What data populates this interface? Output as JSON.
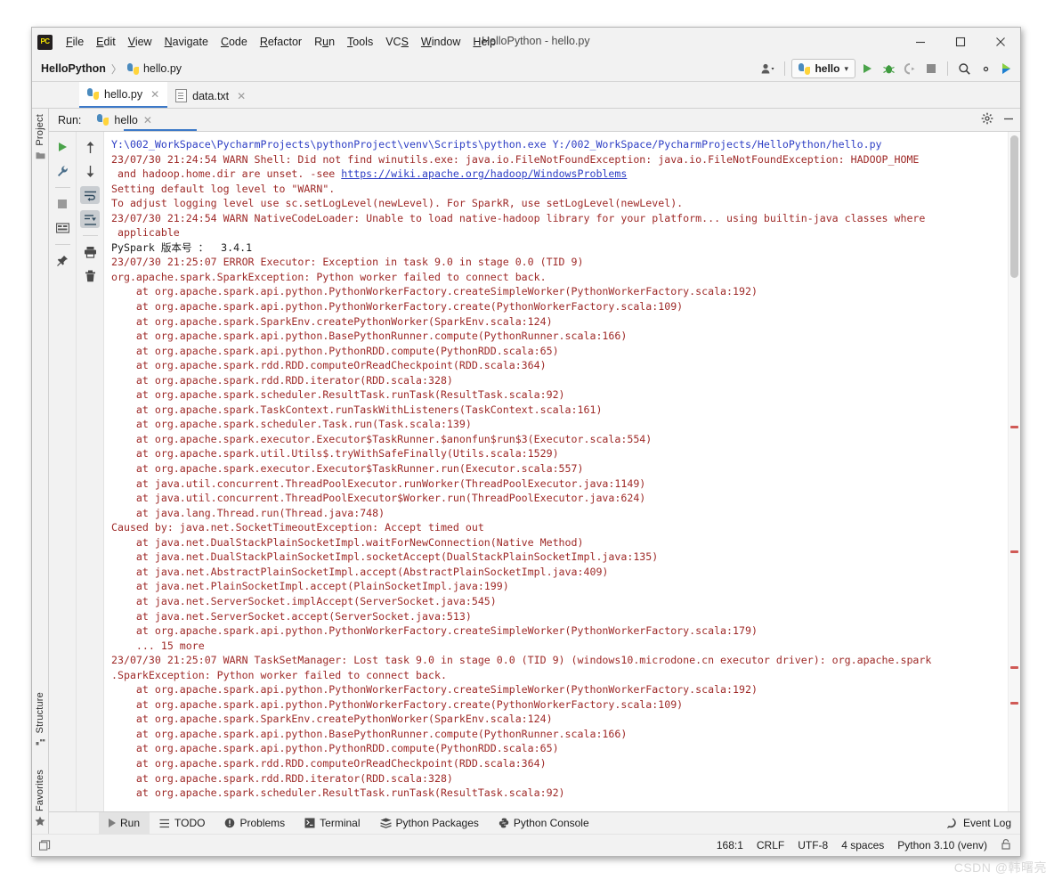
{
  "window": {
    "title": "HelloPython - hello.py",
    "logo_text": "PC",
    "minimize": "—",
    "maximize": "☐",
    "close": "✕"
  },
  "menu": [
    {
      "label": "File"
    },
    {
      "label": "Edit"
    },
    {
      "label": "View"
    },
    {
      "label": "Navigate"
    },
    {
      "label": "Code"
    },
    {
      "label": "Refactor"
    },
    {
      "label": "Run"
    },
    {
      "label": "Tools"
    },
    {
      "label": "VCS"
    },
    {
      "label": "Window"
    },
    {
      "label": "Help"
    }
  ],
  "breadcrumb": {
    "project": "HelloPython",
    "separator": "〉",
    "file": "hello.py"
  },
  "toolbar": {
    "run_config": "hello",
    "dropdown_caret": "▾",
    "icons": [
      "user-avatar-icon",
      "run-icon",
      "debug-icon",
      "coverage-icon",
      "stop-icon",
      "search-icon",
      "settings-icon",
      "updates-icon"
    ]
  },
  "editor_tabs": [
    {
      "label": "hello.py",
      "icon": "python-file-icon",
      "active": true,
      "close": "✕"
    },
    {
      "label": "data.txt",
      "icon": "text-file-icon",
      "active": false,
      "close": "✕"
    }
  ],
  "left_strip": {
    "project": "Project",
    "structure": "Structure",
    "favorites": "Favorites"
  },
  "run_panel": {
    "title": "Run:",
    "tab_label": "hello",
    "tab_close": "✕",
    "settings_icon": "gear-icon",
    "minimize_icon": "minimize-icon",
    "gutter_left": [
      "rerun-icon",
      "settings-wrench-icon",
      "stop-icon",
      "layout-icon",
      "pin-icon"
    ],
    "gutter_right": [
      "up-arrow-icon",
      "down-arrow-icon",
      "soft-wrap-icon",
      "scroll-to-end-icon",
      "print-icon",
      "trash-icon"
    ]
  },
  "console": {
    "lines": [
      {
        "t": "Y:\\002_WorkSpace\\PycharmProjects\\pythonProject\\venv\\Scripts\\python.exe Y:/002_WorkSpace/PycharmProjects/HelloPython/hello.py",
        "c": "blue"
      },
      {
        "t": "23/07/30 21:24:54 WARN Shell: Did not find winutils.exe: java.io.FileNotFoundException: java.io.FileNotFoundException: HADOOP_HOME",
        "c": "red"
      },
      {
        "t": " and hadoop.home.dir are unset. -see ",
        "c": "red",
        "link": "https://wiki.apache.org/hadoop/WindowsProblems"
      },
      {
        "t": "Setting default log level to \"WARN\".",
        "c": "red"
      },
      {
        "t": "To adjust logging level use sc.setLogLevel(newLevel). For SparkR, use setLogLevel(newLevel).",
        "c": "red"
      },
      {
        "t": "23/07/30 21:24:54 WARN NativeCodeLoader: Unable to load native-hadoop library for your platform... using builtin-java classes where",
        "c": "red"
      },
      {
        "t": " applicable",
        "c": "red"
      },
      {
        "t": "PySpark 版本号 ：  3.4.1",
        "c": "black"
      },
      {
        "t": "23/07/30 21:25:07 ERROR Executor: Exception in task 9.0 in stage 0.0 (TID 9)",
        "c": "red"
      },
      {
        "t": "org.apache.spark.SparkException: Python worker failed to connect back.",
        "c": "red"
      },
      {
        "t": "    at org.apache.spark.api.python.PythonWorkerFactory.createSimpleWorker(PythonWorkerFactory.scala:192)",
        "c": "red"
      },
      {
        "t": "    at org.apache.spark.api.python.PythonWorkerFactory.create(PythonWorkerFactory.scala:109)",
        "c": "red"
      },
      {
        "t": "    at org.apache.spark.SparkEnv.createPythonWorker(SparkEnv.scala:124)",
        "c": "red"
      },
      {
        "t": "    at org.apache.spark.api.python.BasePythonRunner.compute(PythonRunner.scala:166)",
        "c": "red"
      },
      {
        "t": "    at org.apache.spark.api.python.PythonRDD.compute(PythonRDD.scala:65)",
        "c": "red"
      },
      {
        "t": "    at org.apache.spark.rdd.RDD.computeOrReadCheckpoint(RDD.scala:364)",
        "c": "red"
      },
      {
        "t": "    at org.apache.spark.rdd.RDD.iterator(RDD.scala:328)",
        "c": "red"
      },
      {
        "t": "    at org.apache.spark.scheduler.ResultTask.runTask(ResultTask.scala:92)",
        "c": "red"
      },
      {
        "t": "    at org.apache.spark.TaskContext.runTaskWithListeners(TaskContext.scala:161)",
        "c": "red"
      },
      {
        "t": "    at org.apache.spark.scheduler.Task.run(Task.scala:139)",
        "c": "red"
      },
      {
        "t": "    at org.apache.spark.executor.Executor$TaskRunner.$anonfun$run$3(Executor.scala:554)",
        "c": "red"
      },
      {
        "t": "    at org.apache.spark.util.Utils$.tryWithSafeFinally(Utils.scala:1529)",
        "c": "red"
      },
      {
        "t": "    at org.apache.spark.executor.Executor$TaskRunner.run(Executor.scala:557)",
        "c": "red"
      },
      {
        "t": "    at java.util.concurrent.ThreadPoolExecutor.runWorker(ThreadPoolExecutor.java:1149)",
        "c": "red"
      },
      {
        "t": "    at java.util.concurrent.ThreadPoolExecutor$Worker.run(ThreadPoolExecutor.java:624)",
        "c": "red"
      },
      {
        "t": "    at java.lang.Thread.run(Thread.java:748)",
        "c": "red"
      },
      {
        "t": "Caused by: java.net.SocketTimeoutException: Accept timed out",
        "c": "red"
      },
      {
        "t": "    at java.net.DualStackPlainSocketImpl.waitForNewConnection(Native Method)",
        "c": "red"
      },
      {
        "t": "    at java.net.DualStackPlainSocketImpl.socketAccept(DualStackPlainSocketImpl.java:135)",
        "c": "red"
      },
      {
        "t": "    at java.net.AbstractPlainSocketImpl.accept(AbstractPlainSocketImpl.java:409)",
        "c": "red"
      },
      {
        "t": "    at java.net.PlainSocketImpl.accept(PlainSocketImpl.java:199)",
        "c": "red"
      },
      {
        "t": "    at java.net.ServerSocket.implAccept(ServerSocket.java:545)",
        "c": "red"
      },
      {
        "t": "    at java.net.ServerSocket.accept(ServerSocket.java:513)",
        "c": "red"
      },
      {
        "t": "    at org.apache.spark.api.python.PythonWorkerFactory.createSimpleWorker(PythonWorkerFactory.scala:179)",
        "c": "red"
      },
      {
        "t": "    ... 15 more",
        "c": "red"
      },
      {
        "t": "23/07/30 21:25:07 WARN TaskSetManager: Lost task 9.0 in stage 0.0 (TID 9) (windows10.microdone.cn executor driver): org.apache.spark",
        "c": "red"
      },
      {
        "t": ".SparkException: Python worker failed to connect back.",
        "c": "red"
      },
      {
        "t": "    at org.apache.spark.api.python.PythonWorkerFactory.createSimpleWorker(PythonWorkerFactory.scala:192)",
        "c": "red"
      },
      {
        "t": "    at org.apache.spark.api.python.PythonWorkerFactory.create(PythonWorkerFactory.scala:109)",
        "c": "red"
      },
      {
        "t": "    at org.apache.spark.SparkEnv.createPythonWorker(SparkEnv.scala:124)",
        "c": "red"
      },
      {
        "t": "    at org.apache.spark.api.python.BasePythonRunner.compute(PythonRunner.scala:166)",
        "c": "red"
      },
      {
        "t": "    at org.apache.spark.api.python.PythonRDD.compute(PythonRDD.scala:65)",
        "c": "red"
      },
      {
        "t": "    at org.apache.spark.rdd.RDD.computeOrReadCheckpoint(RDD.scala:364)",
        "c": "red"
      },
      {
        "t": "    at org.apache.spark.rdd.RDD.iterator(RDD.scala:328)",
        "c": "red"
      },
      {
        "t": "    at org.apache.spark.scheduler.ResultTask.runTask(ResultTask.scala:92)",
        "c": "red"
      }
    ]
  },
  "bottom_bar": {
    "items": [
      {
        "label": "Run",
        "icon": "run-icon",
        "active": true
      },
      {
        "label": "TODO",
        "icon": "todo-icon",
        "active": false
      },
      {
        "label": "Problems",
        "icon": "problems-icon",
        "active": false
      },
      {
        "label": "Terminal",
        "icon": "terminal-icon",
        "active": false
      },
      {
        "label": "Python Packages",
        "icon": "packages-icon",
        "active": false
      },
      {
        "label": "Python Console",
        "icon": "python-console-icon",
        "active": false
      }
    ],
    "event_log": "Event Log",
    "event_log_icon": "event-log-icon"
  },
  "status_bar": {
    "caret": "168:1",
    "line_separator": "CRLF",
    "encoding": "UTF-8",
    "indent": "4 spaces",
    "interpreter": "Python 3.10 (venv)",
    "lock_icon": "lock-icon"
  },
  "watermark": "CSDN @韩曙亮",
  "colors": {
    "error_text": "#9e2927",
    "link_text": "#2d3ec4",
    "accent": "#3c79c8",
    "chrome": "#f2f2f2"
  }
}
